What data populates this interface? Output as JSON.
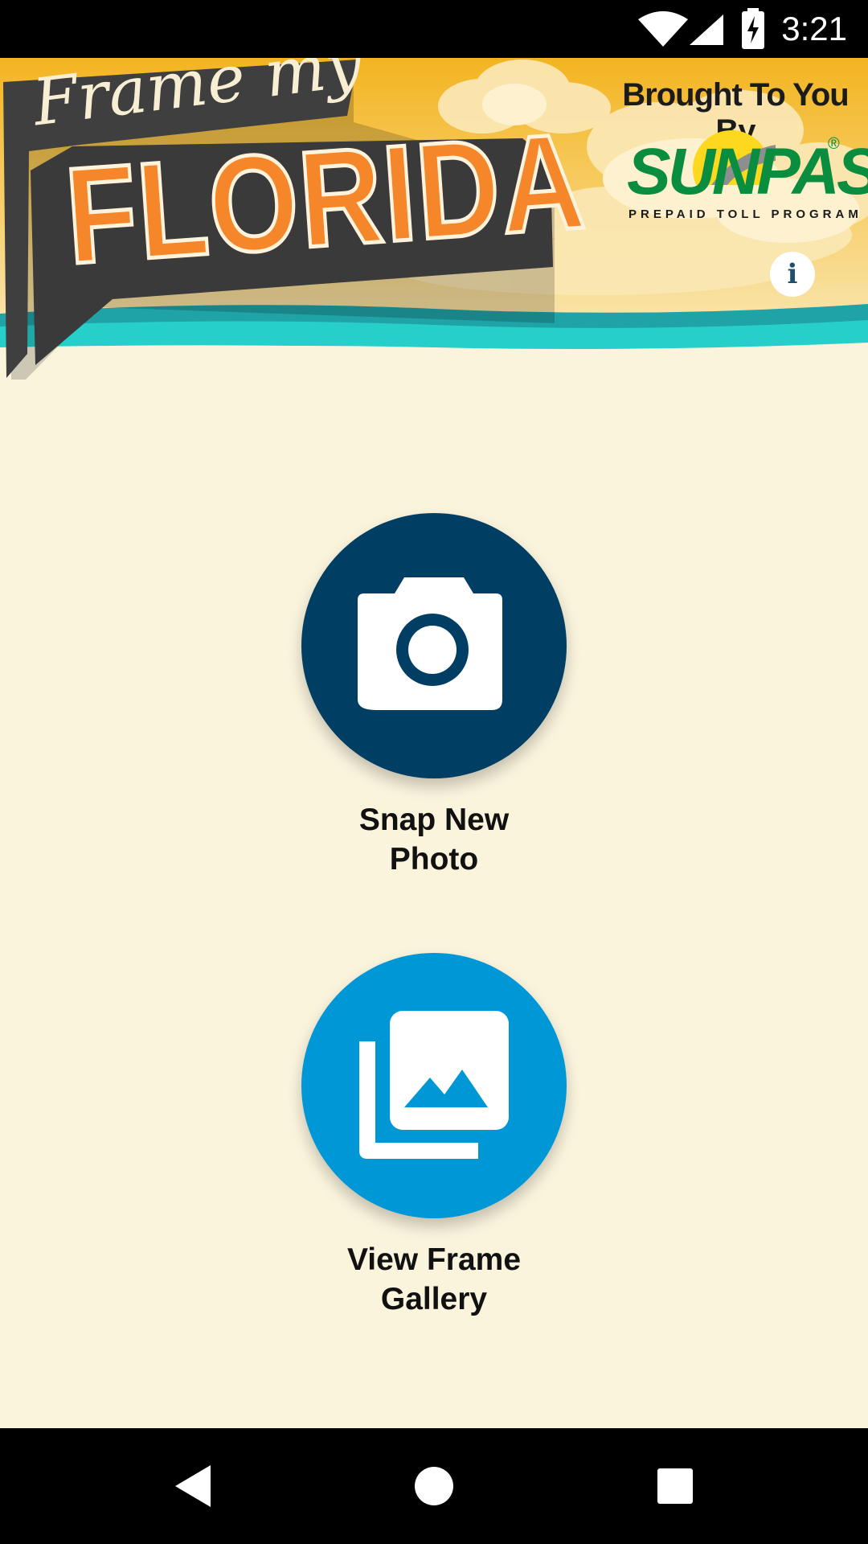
{
  "status_bar": {
    "time": "3:21",
    "icons": [
      "wifi-icon",
      "cell-signal-icon",
      "battery-charging-icon"
    ]
  },
  "header": {
    "brand": {
      "line1": "Frame my",
      "line2": "FLORIDA"
    },
    "sponsor": {
      "caption": "Brought To You By",
      "name": "SUNPASS",
      "tagline": "PREPAID TOLL PROGRAM",
      "registered": "®"
    },
    "info_button": "i"
  },
  "actions": {
    "snap": {
      "icon": "camera-icon",
      "label_line1": "Snap New",
      "label_line2": "Photo"
    },
    "gallery": {
      "icon": "gallery-icon",
      "label_line1": "View Frame",
      "label_line2": "Gallery"
    }
  },
  "nav_bar": {
    "buttons": [
      "back-icon",
      "home-icon",
      "recents-icon"
    ]
  },
  "colors": {
    "background": "#faf4dd",
    "snap_circle": "#003e63",
    "gallery_circle": "#0097d6",
    "sky": "#f3b92a",
    "water": "#1ec7c7",
    "logo_orange": "#f5862a",
    "sunpass_green": "#0a8d3e"
  }
}
